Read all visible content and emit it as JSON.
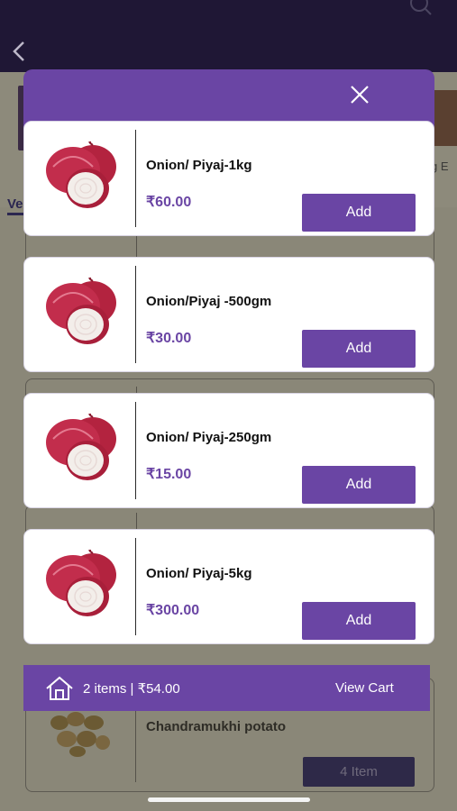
{
  "background": {
    "tab_label_partial": "Ve",
    "right_label_partial": "g E",
    "item": {
      "name": "Chandramukhi potato",
      "button": "4 Item"
    }
  },
  "products": [
    {
      "name": "Onion/ Piyaj-1kg",
      "price": "₹60.00",
      "button": "Add"
    },
    {
      "name": "Onion/Piyaj -500gm",
      "price": "₹30.00",
      "button": "Add"
    },
    {
      "name": "Onion/ Piyaj-250gm",
      "price": "₹15.00",
      "button": "Add"
    },
    {
      "name": "Onion/ Piyaj-5kg",
      "price": "₹300.00",
      "button": "Add"
    }
  ],
  "cart": {
    "summary": "2 items |  ₹54.00",
    "view_cart": "View Cart"
  },
  "colors": {
    "accent": "#6a45a4",
    "header": "#1f1735",
    "overlay": "#8a8778"
  }
}
